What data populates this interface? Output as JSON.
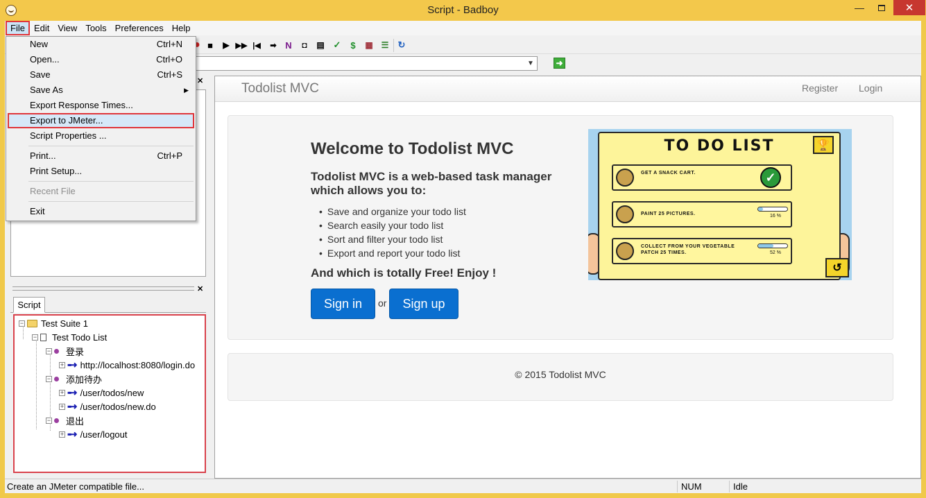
{
  "window": {
    "title": "Script - Badboy",
    "minimize": "—",
    "close": "✕"
  },
  "menubar": [
    "File",
    "Edit",
    "View",
    "Tools",
    "Preferences",
    "Help"
  ],
  "file_menu": {
    "new": {
      "label": "New",
      "shortcut": "Ctrl+N"
    },
    "open": {
      "label": "Open...",
      "shortcut": "Ctrl+O"
    },
    "save": {
      "label": "Save",
      "shortcut": "Ctrl+S"
    },
    "save_as": {
      "label": "Save As",
      "submenu": "▶"
    },
    "export_response": {
      "label": "Export Response Times..."
    },
    "export_jmeter": {
      "label": "Export to JMeter..."
    },
    "script_props": {
      "label": "Script Properties ..."
    },
    "print": {
      "label": "Print...",
      "shortcut": "Ctrl+P"
    },
    "print_setup": {
      "label": "Print Setup..."
    },
    "recent": {
      "label": "Recent File"
    },
    "exit": {
      "label": "Exit"
    }
  },
  "toolbar_icons": [
    "record-icon",
    "stop-icon",
    "play-icon",
    "fast-forward-icon",
    "rewind-icon",
    "step-icon",
    "n-icon",
    "camera-icon",
    "document-icon",
    "check-icon",
    "dollar-icon",
    "grid-icon",
    "tree-icon",
    "refresh-icon"
  ],
  "panels": {
    "close_glyph": "✕",
    "script_tab": "Script"
  },
  "tree": {
    "suite": "Test Suite 1",
    "test": "Test Todo List",
    "step_login": "登录",
    "req_login": "http://localhost:8080/login.do",
    "step_add": "添加待办",
    "req_new": "/user/todos/new",
    "req_new_do": "/user/todos/new.do",
    "step_logout": "退出",
    "req_logout": "/user/logout"
  },
  "web": {
    "brand": "Todolist MVC",
    "register": "Register",
    "login": "Login",
    "welcome": "Welcome to Todolist MVC",
    "description": "Todolist MVC is a web-based task manager which allows you to:",
    "features": [
      "Save and organize your todo list",
      "Search easily your todo list",
      "Sort and filter your todo list",
      "Export and report your todo list"
    ],
    "free": "And which is totally Free! Enjoy !",
    "sign_in": "Sign in",
    "or": "or",
    "sign_up": "Sign up",
    "footer": "© 2015 Todolist MVC",
    "image": {
      "title": "TO DO LIST",
      "row1": "GET A SNACK CART.",
      "row2": "PAINT 25 PICTURES.",
      "row2_pct": "16 %",
      "row2_progress": 0.16,
      "row3": "COLLECT FROM YOUR VEGETABLE PATCH 25 TIMES.",
      "row3_pct": "52 %",
      "row3_progress": 0.52
    }
  },
  "statusbar": {
    "message": "Create an JMeter compatible file...",
    "num": "NUM",
    "state": "Idle"
  },
  "colors": {
    "window_frame": "#f3c84b",
    "highlight_outline": "#e0353a",
    "primary_button": "#0a6fd0"
  }
}
